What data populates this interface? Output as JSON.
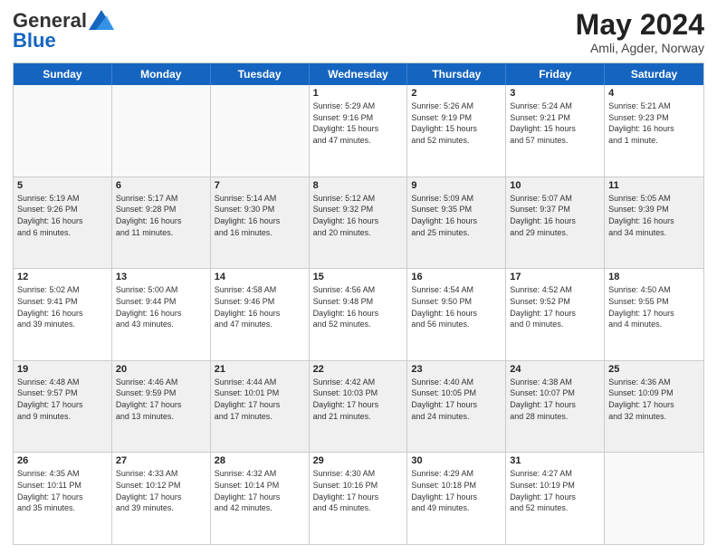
{
  "header": {
    "logo_general": "General",
    "logo_blue": "Blue",
    "month_year": "May 2024",
    "location": "Amli, Agder, Norway"
  },
  "days_of_week": [
    "Sunday",
    "Monday",
    "Tuesday",
    "Wednesday",
    "Thursday",
    "Friday",
    "Saturday"
  ],
  "rows": [
    [
      {
        "day": "",
        "info": ""
      },
      {
        "day": "",
        "info": ""
      },
      {
        "day": "",
        "info": ""
      },
      {
        "day": "1",
        "info": "Sunrise: 5:29 AM\nSunset: 9:16 PM\nDaylight: 15 hours\nand 47 minutes."
      },
      {
        "day": "2",
        "info": "Sunrise: 5:26 AM\nSunset: 9:19 PM\nDaylight: 15 hours\nand 52 minutes."
      },
      {
        "day": "3",
        "info": "Sunrise: 5:24 AM\nSunset: 9:21 PM\nDaylight: 15 hours\nand 57 minutes."
      },
      {
        "day": "4",
        "info": "Sunrise: 5:21 AM\nSunset: 9:23 PM\nDaylight: 16 hours\nand 1 minute."
      }
    ],
    [
      {
        "day": "5",
        "info": "Sunrise: 5:19 AM\nSunset: 9:26 PM\nDaylight: 16 hours\nand 6 minutes."
      },
      {
        "day": "6",
        "info": "Sunrise: 5:17 AM\nSunset: 9:28 PM\nDaylight: 16 hours\nand 11 minutes."
      },
      {
        "day": "7",
        "info": "Sunrise: 5:14 AM\nSunset: 9:30 PM\nDaylight: 16 hours\nand 16 minutes."
      },
      {
        "day": "8",
        "info": "Sunrise: 5:12 AM\nSunset: 9:32 PM\nDaylight: 16 hours\nand 20 minutes."
      },
      {
        "day": "9",
        "info": "Sunrise: 5:09 AM\nSunset: 9:35 PM\nDaylight: 16 hours\nand 25 minutes."
      },
      {
        "day": "10",
        "info": "Sunrise: 5:07 AM\nSunset: 9:37 PM\nDaylight: 16 hours\nand 29 minutes."
      },
      {
        "day": "11",
        "info": "Sunrise: 5:05 AM\nSunset: 9:39 PM\nDaylight: 16 hours\nand 34 minutes."
      }
    ],
    [
      {
        "day": "12",
        "info": "Sunrise: 5:02 AM\nSunset: 9:41 PM\nDaylight: 16 hours\nand 39 minutes."
      },
      {
        "day": "13",
        "info": "Sunrise: 5:00 AM\nSunset: 9:44 PM\nDaylight: 16 hours\nand 43 minutes."
      },
      {
        "day": "14",
        "info": "Sunrise: 4:58 AM\nSunset: 9:46 PM\nDaylight: 16 hours\nand 47 minutes."
      },
      {
        "day": "15",
        "info": "Sunrise: 4:56 AM\nSunset: 9:48 PM\nDaylight: 16 hours\nand 52 minutes."
      },
      {
        "day": "16",
        "info": "Sunrise: 4:54 AM\nSunset: 9:50 PM\nDaylight: 16 hours\nand 56 minutes."
      },
      {
        "day": "17",
        "info": "Sunrise: 4:52 AM\nSunset: 9:52 PM\nDaylight: 17 hours\nand 0 minutes."
      },
      {
        "day": "18",
        "info": "Sunrise: 4:50 AM\nSunset: 9:55 PM\nDaylight: 17 hours\nand 4 minutes."
      }
    ],
    [
      {
        "day": "19",
        "info": "Sunrise: 4:48 AM\nSunset: 9:57 PM\nDaylight: 17 hours\nand 9 minutes."
      },
      {
        "day": "20",
        "info": "Sunrise: 4:46 AM\nSunset: 9:59 PM\nDaylight: 17 hours\nand 13 minutes."
      },
      {
        "day": "21",
        "info": "Sunrise: 4:44 AM\nSunset: 10:01 PM\nDaylight: 17 hours\nand 17 minutes."
      },
      {
        "day": "22",
        "info": "Sunrise: 4:42 AM\nSunset: 10:03 PM\nDaylight: 17 hours\nand 21 minutes."
      },
      {
        "day": "23",
        "info": "Sunrise: 4:40 AM\nSunset: 10:05 PM\nDaylight: 17 hours\nand 24 minutes."
      },
      {
        "day": "24",
        "info": "Sunrise: 4:38 AM\nSunset: 10:07 PM\nDaylight: 17 hours\nand 28 minutes."
      },
      {
        "day": "25",
        "info": "Sunrise: 4:36 AM\nSunset: 10:09 PM\nDaylight: 17 hours\nand 32 minutes."
      }
    ],
    [
      {
        "day": "26",
        "info": "Sunrise: 4:35 AM\nSunset: 10:11 PM\nDaylight: 17 hours\nand 35 minutes."
      },
      {
        "day": "27",
        "info": "Sunrise: 4:33 AM\nSunset: 10:12 PM\nDaylight: 17 hours\nand 39 minutes."
      },
      {
        "day": "28",
        "info": "Sunrise: 4:32 AM\nSunset: 10:14 PM\nDaylight: 17 hours\nand 42 minutes."
      },
      {
        "day": "29",
        "info": "Sunrise: 4:30 AM\nSunset: 10:16 PM\nDaylight: 17 hours\nand 45 minutes."
      },
      {
        "day": "30",
        "info": "Sunrise: 4:29 AM\nSunset: 10:18 PM\nDaylight: 17 hours\nand 49 minutes."
      },
      {
        "day": "31",
        "info": "Sunrise: 4:27 AM\nSunset: 10:19 PM\nDaylight: 17 hours\nand 52 minutes."
      },
      {
        "day": "",
        "info": ""
      }
    ]
  ]
}
